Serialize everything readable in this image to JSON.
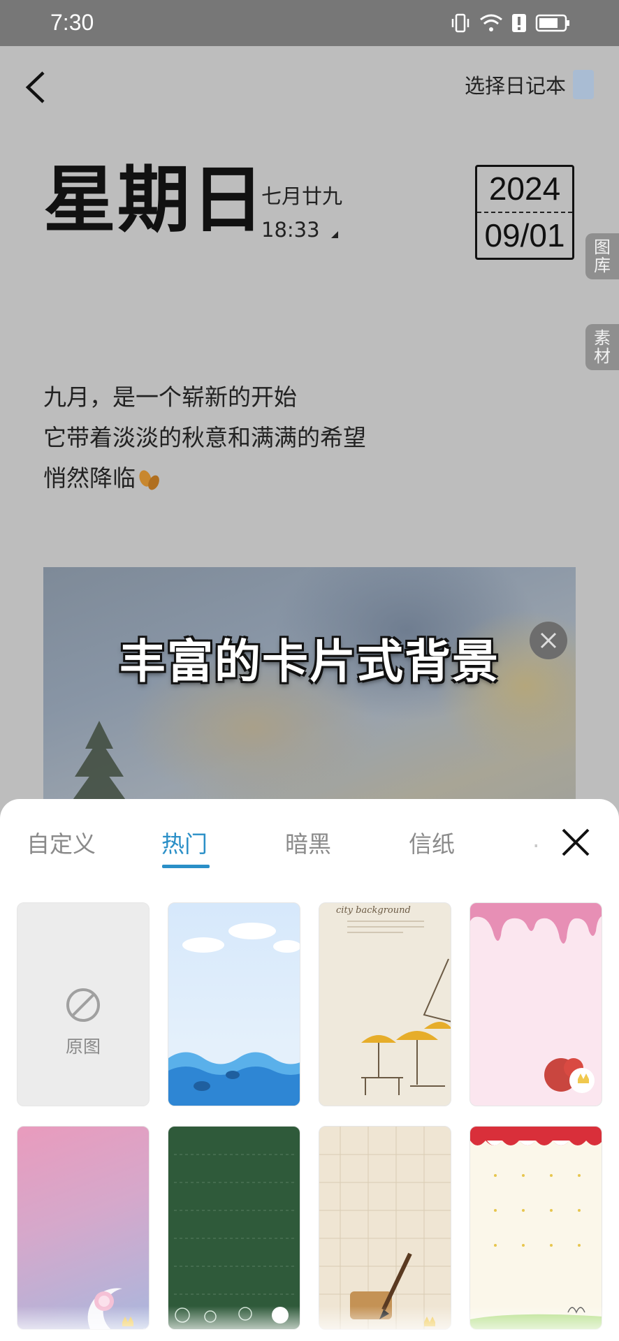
{
  "status_bar": {
    "time": "7:30"
  },
  "header": {
    "select_notebook": "选择日记本",
    "swatch_color": "#a9bcd3"
  },
  "entry": {
    "weekday": "星期日",
    "lunar_date": "七月廿九",
    "time": "18:33",
    "year": "2024",
    "month_day": "09/01",
    "lines": [
      "九月，是一个崭新的开始",
      "它带着淡淡的秋意和满满的希望",
      "悄然降临"
    ]
  },
  "side_tabs": {
    "gallery": "图\n库",
    "material": "素\n材"
  },
  "photo": {
    "caption": "丰富的卡片式背景"
  },
  "sheet": {
    "tabs": [
      {
        "label": "自定义"
      },
      {
        "label": "热门"
      },
      {
        "label": "暗黑"
      },
      {
        "label": "信纸"
      }
    ],
    "active_tab": "热门",
    "original_label": "原图",
    "handwritten_text": "city background"
  },
  "colors": {
    "accent": "#2a8fc7",
    "page_bg": "#bdbdbd",
    "status_bar": "#777777"
  }
}
